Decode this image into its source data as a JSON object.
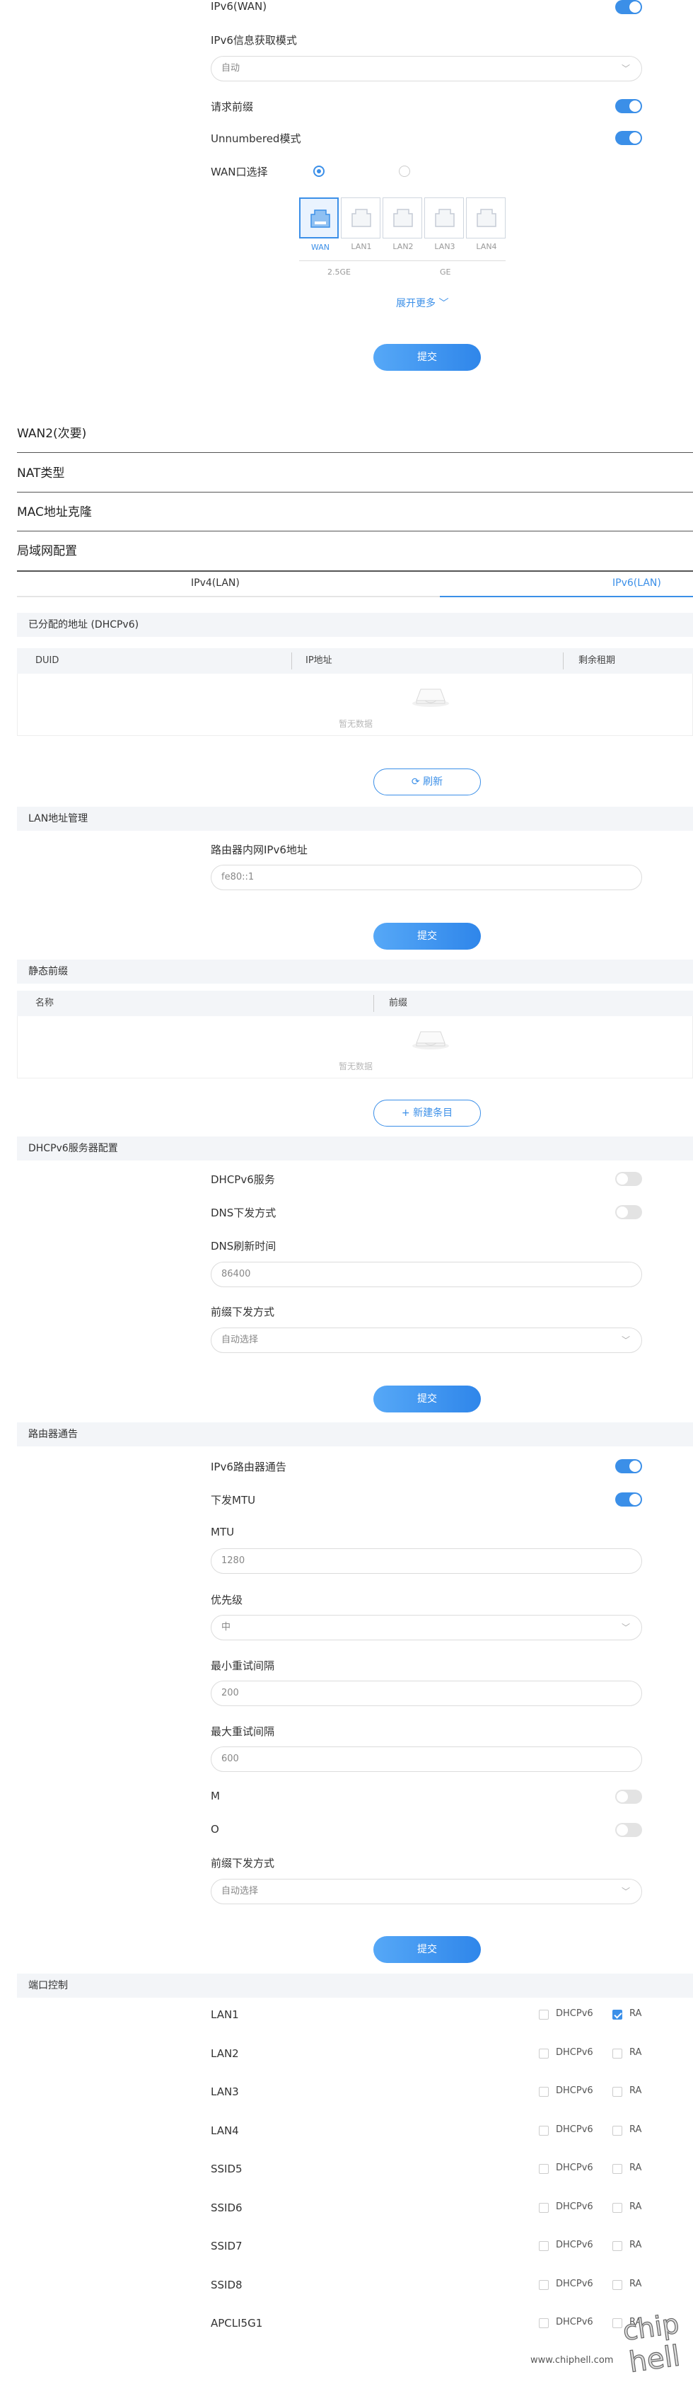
{
  "wan6": {
    "ipv6_wan_label": "IPv6(WAN)",
    "mode_label": "IPv6信息获取模式",
    "mode_value": "自动",
    "request_prefix_label": "请求前缀",
    "unnumbered_label": "Unnumbered模式",
    "wan_port_label": "WAN口选择",
    "ports": [
      "WAN",
      "LAN1",
      "LAN2",
      "LAN3",
      "LAN4"
    ],
    "speed_25": "2.5GE",
    "speed_ge": "GE",
    "expand_more": "展开更多",
    "submit": "提交"
  },
  "folds": {
    "wan2": "WAN2(次要)",
    "nat": "NAT类型",
    "mac": "MAC地址克隆",
    "lan": "局域网配置"
  },
  "tabs": {
    "ipv4": "IPv4(LAN)",
    "ipv6": "IPv6(LAN)"
  },
  "assigned": {
    "title": "已分配的地址 (DHCPv6)",
    "col_duid": "DUID",
    "col_ip": "IP地址",
    "col_lease": "剩余租期",
    "empty": "暂无数据",
    "refresh": "刷新"
  },
  "lan_addr": {
    "title": "LAN地址管理",
    "ipv6_label": "路由器内网IPv6地址",
    "ipv6_value": "fe80::1",
    "submit": "提交"
  },
  "static_prefix": {
    "title": "静态前缀",
    "col_name": "名称",
    "col_prefix": "前缀",
    "empty": "暂无数据",
    "add": "+ 新建条目"
  },
  "dhcp6": {
    "title": "DHCPv6服务器配置",
    "service_label": "DHCPv6服务",
    "dns_label": "DNS下发方式",
    "dns_refresh_label": "DNS刷新时间",
    "dns_refresh_value": "86400",
    "prefix_mode_label": "前缀下发方式",
    "prefix_mode_value": "自动选择",
    "submit": "提交"
  },
  "ra": {
    "title": "路由器通告",
    "ipv6_ra_label": "IPv6路由器通告",
    "mtu_send_label": "下发MTU",
    "mtu_label": "MTU",
    "mtu_value": "1280",
    "priority_label": "优先级",
    "priority_value": "中",
    "min_interval_label": "最小重试间隔",
    "min_interval_value": "200",
    "max_interval_label": "最大重试间隔",
    "max_interval_value": "600",
    "m_label": "M",
    "o_label": "O",
    "prefix_mode_label": "前缀下发方式",
    "prefix_mode_value": "自动选择",
    "submit": "提交"
  },
  "port_ctrl": {
    "title": "端口控制",
    "dhcpv6": "DHCPv6",
    "ra": "RA",
    "ports": [
      {
        "name": "LAN1",
        "dhcpv6": false,
        "ra": true
      },
      {
        "name": "LAN2",
        "dhcpv6": false,
        "ra": false
      },
      {
        "name": "LAN3",
        "dhcpv6": false,
        "ra": false
      },
      {
        "name": "LAN4",
        "dhcpv6": false,
        "ra": false
      },
      {
        "name": "SSID5",
        "dhcpv6": false,
        "ra": false
      },
      {
        "name": "SSID6",
        "dhcpv6": false,
        "ra": false
      },
      {
        "name": "SSID7",
        "dhcpv6": false,
        "ra": false
      },
      {
        "name": "SSID8",
        "dhcpv6": false,
        "ra": false
      },
      {
        "name": "APCLI5G1",
        "dhcpv6": false,
        "ra": false
      }
    ]
  },
  "watermark": {
    "text": "www.chiphell.com"
  },
  "colors": {
    "accent": "#3b8fe8",
    "section_bg": "#f3f5f8"
  }
}
